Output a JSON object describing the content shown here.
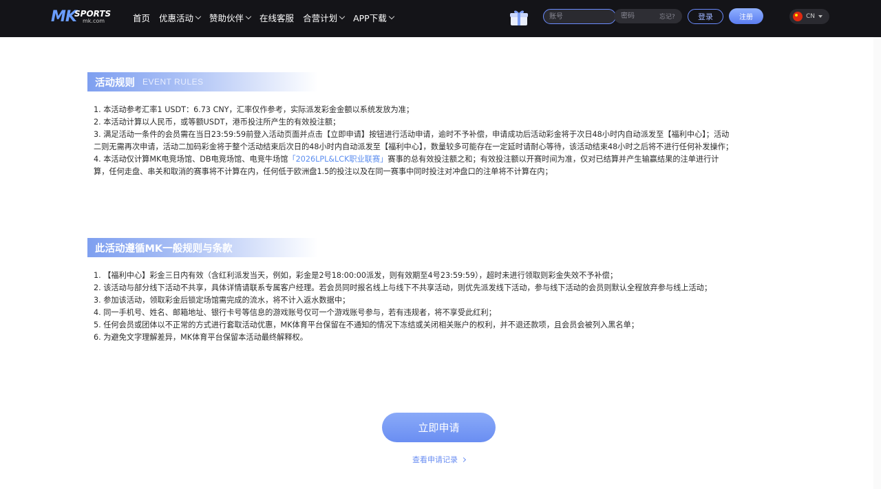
{
  "header": {
    "logo_mk": "MK",
    "logo_sports": "SPORTS",
    "logo_domain": "mk.com",
    "nav": [
      {
        "label": "首页",
        "dropdown": false
      },
      {
        "label": "优惠活动",
        "dropdown": true
      },
      {
        "label": "赞助伙伴",
        "dropdown": true
      },
      {
        "label": "在线客服",
        "dropdown": false
      },
      {
        "label": "合营计划",
        "dropdown": true
      },
      {
        "label": "APP下载",
        "dropdown": true
      }
    ],
    "account_placeholder": "账号",
    "password_placeholder": "密码",
    "forgot_label": "忘记?",
    "login_label": "登录",
    "register_label": "注册",
    "language": "CN",
    "accent_color": "#6b8cff"
  },
  "section1": {
    "title": "活动规则",
    "subtitle": "EVENT RULES",
    "items": [
      {
        "text": "1. 本活动参考汇率1 USDT：6.73 CNY，汇率仅作参考，实际派发彩金金额以系统发放为准；"
      },
      {
        "text": "2. 本活动计算以人民币，或等额USDT，港币投注所产生的有效投注额；"
      },
      {
        "text": "3. 满足活动一条件的会员需在当日23:59:59前登入活动页面并点击【立即申请】按钮进行活动申请，逾时不予补偿，申请成功后活动彩金将于次日48小时内自动派发至【福利中心】；活动二则无需再次申请，活动二加码彩金将于整个活动结束后次日的48小时内自动派发至【福利中心】，数量较多可能存在一定延时请耐心等待，该活动结束48小时之后将不进行任何补发操作；"
      },
      {
        "pre": "4. 本活动仅计算MK电竞场馆、DB电竞场馆、电竞牛场馆",
        "link": "「2026LPL&LCK职业联赛」",
        "post": "赛事的总有效投注额之和；有效投注额以开赛时间为准，仅对已结算并产生输赢结果的注单进行计算，任何走盘、串关和取消的赛事将不计算在内，任何低于欧洲盘1.5的投注以及在同一赛事中同时投注对冲盘口的注单将不计算在内；"
      }
    ]
  },
  "section2": {
    "title": "此活动遵循MK一般规则与条款",
    "items": [
      "1. 【福利中心】彩金三日内有效（含红利派发当天，例如，彩金是2号18:00:00派发，则有效期至4号23:59:59），超时未进行领取则彩金失效不予补偿；",
      "2. 该活动与部分线下活动不共享，具体详情请联系专属客户经理。若会员同时报名线上与线下不共享活动，则优先派发线下活动，参与线下活动的会员则默认全程放弃参与线上活动；",
      "3. 参加该活动，领取彩金后锁定场馆需完成的流水，将不计入返水数据中；",
      "4. 同一手机号、姓名、邮箱地址、银行卡号等信息的游戏账号仅可一个游戏账号参与，若有违规者，将不享受此红利；",
      "5. 任何会员或团体以不正常的方式进行套取活动优惠，MK体育平台保留在不通知的情况下冻结或关闭相关账户的权利，并不退还款项，且会员会被列入黑名单；",
      "6. 为避免文字理解差异，MK体育平台保留本活动最终解释权。"
    ]
  },
  "apply_label": "立即申请",
  "record_link_label": "查看申请记录",
  "icons": {
    "gift": "gift-icon",
    "flag": "china-flag-icon"
  }
}
